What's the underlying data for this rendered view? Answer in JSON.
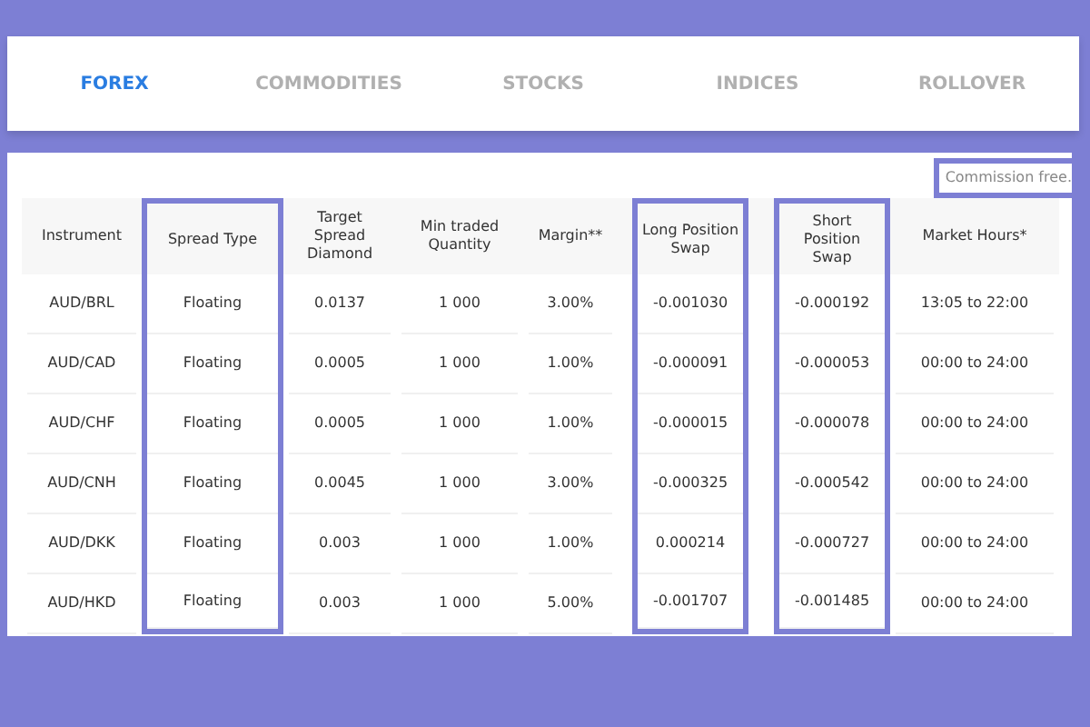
{
  "tabs": [
    {
      "label": "FOREX",
      "selected": true
    },
    {
      "label": "COMMODITIES",
      "selected": false
    },
    {
      "label": "STOCKS",
      "selected": false
    },
    {
      "label": "INDICES",
      "selected": false
    },
    {
      "label": "ROLLOVER",
      "selected": false
    }
  ],
  "note": {
    "text": "Commission free.",
    "highlighted": true
  },
  "table": {
    "columns": [
      {
        "label": "Instrument",
        "highlighted": false
      },
      {
        "label": "Spread Type",
        "highlighted": true
      },
      {
        "label": "Target Spread Diamond",
        "highlighted": false
      },
      {
        "label": "Min traded Quantity",
        "highlighted": false
      },
      {
        "label": "Margin**",
        "highlighted": false
      },
      {
        "label": "Long Position Swap",
        "highlighted": true
      },
      {
        "label": "Short Position Swap",
        "highlighted": true
      },
      {
        "label": "Market Hours*",
        "highlighted": false
      }
    ],
    "rows": [
      [
        "AUD/BRL",
        "Floating",
        "0.0137",
        "1 000",
        "3.00%",
        "-0.001030",
        "-0.000192",
        "13:05 to 22:00"
      ],
      [
        "AUD/CAD",
        "Floating",
        "0.0005",
        "1 000",
        "1.00%",
        "-0.000091",
        "-0.000053",
        "00:00 to 24:00"
      ],
      [
        "AUD/CHF",
        "Floating",
        "0.0005",
        "1 000",
        "1.00%",
        "-0.000015",
        "-0.000078",
        "00:00 to 24:00"
      ],
      [
        "AUD/CNH",
        "Floating",
        "0.0045",
        "1 000",
        "3.00%",
        "-0.000325",
        "-0.000542",
        "00:00 to 24:00"
      ],
      [
        "AUD/DKK",
        "Floating",
        "0.003",
        "1 000",
        "1.00%",
        "0.000214",
        "-0.000727",
        "00:00 to 24:00"
      ],
      [
        "AUD/HKD",
        "Floating",
        "0.003",
        "1 000",
        "5.00%",
        "-0.001707",
        "-0.001485",
        "00:00 to 24:00"
      ]
    ]
  }
}
